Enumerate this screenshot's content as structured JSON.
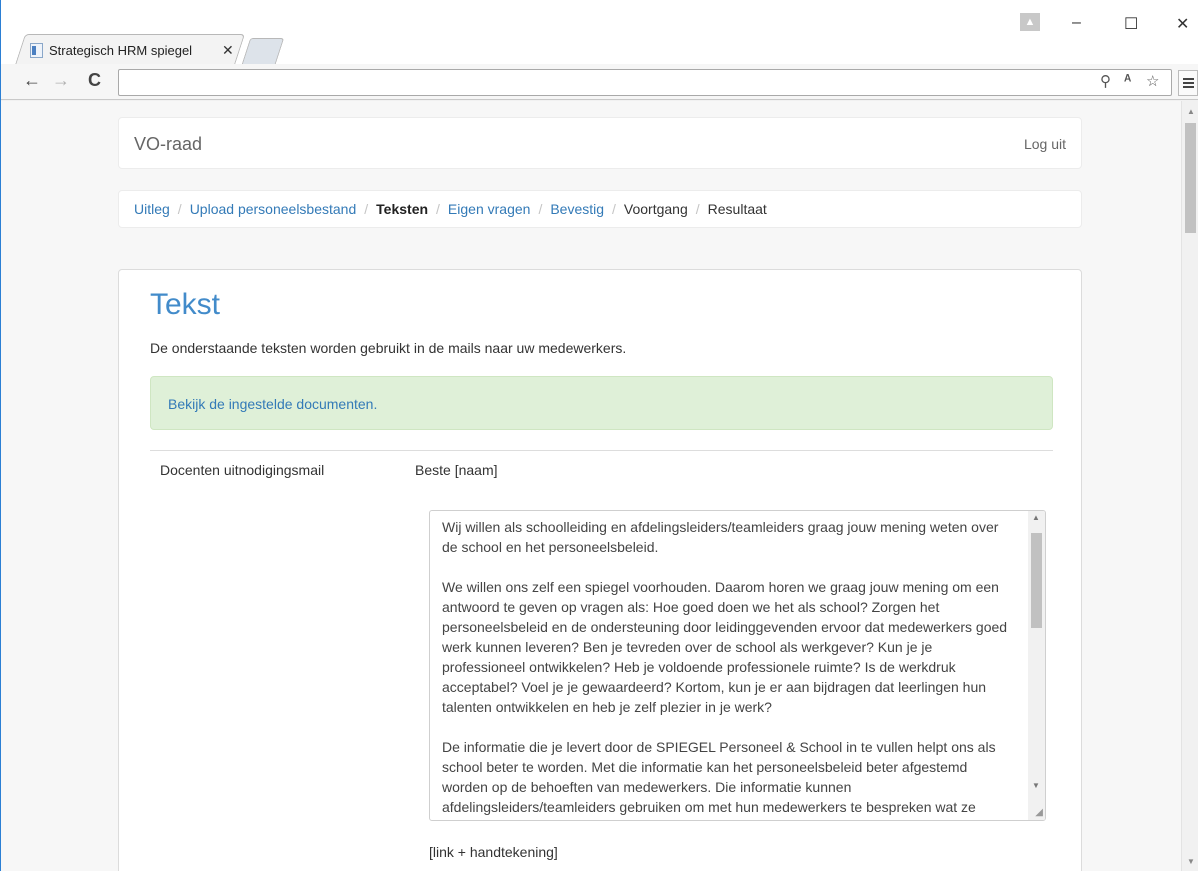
{
  "browser": {
    "tab_title": "Strategisch HRM spiegel",
    "tab_close": "✕",
    "nav_back": "←",
    "nav_forward": "→",
    "nav_reload": "C",
    "window_minimize": "–",
    "window_maximize": "☐",
    "window_close": "✕",
    "user_icon": "▲",
    "omnibox_icons": {
      "zoom": "⚲",
      "translate": "ᴬ",
      "star": "☆"
    }
  },
  "navbar": {
    "brand": "VO-raad",
    "logout": "Log uit"
  },
  "breadcrumb": {
    "items": [
      {
        "label": "Uitleg"
      },
      {
        "label": "Upload personeelsbestand"
      },
      {
        "label": "Teksten"
      },
      {
        "label": "Eigen vragen"
      },
      {
        "label": "Bevestig"
      },
      {
        "label": "Voortgang"
      },
      {
        "label": "Resultaat"
      }
    ],
    "separator": "/"
  },
  "content": {
    "title": "Tekst",
    "description": "De onderstaande teksten worden gebruikt in de mails naar uw medewerkers.",
    "alert_link": "Bekijk de ingestelde documenten.",
    "field_label": "Docenten uitnodigingsmail",
    "greeting": "Beste [naam]",
    "mail_body": "Wij willen als schoolleiding en afdelingsleiders/teamleiders graag jouw mening weten over de school en het personeelsbeleid.\n\nWe willen ons zelf een spiegel voorhouden. Daarom horen we graag jouw mening om een antwoord te geven op vragen als: Hoe goed doen we het als school? Zorgen het personeelsbeleid en de ondersteuning door leidinggevenden ervoor dat medewerkers goed werk kunnen leveren? Ben je tevreden over de school als werkgever? Kun je je professioneel ontwikkelen? Heb je voldoende professionele ruimte? Is de werkdruk acceptabel? Voel je je gewaardeerd? Kortom, kun je er aan bijdragen dat leerlingen hun talenten ontwikkelen en heb je zelf plezier in je werk?\n\nDe informatie die je levert door de SPIEGEL Personeel & School in te vullen helpt ons als school beter te worden. Met die informatie kan het personeelsbeleid beter afgestemd worden op de behoeften van medewerkers. Die informatie kunnen afdelingsleiders/teamleiders gebruiken om met hun medewerkers te bespreken wat ze",
    "signature": "[link + handtekening]"
  }
}
